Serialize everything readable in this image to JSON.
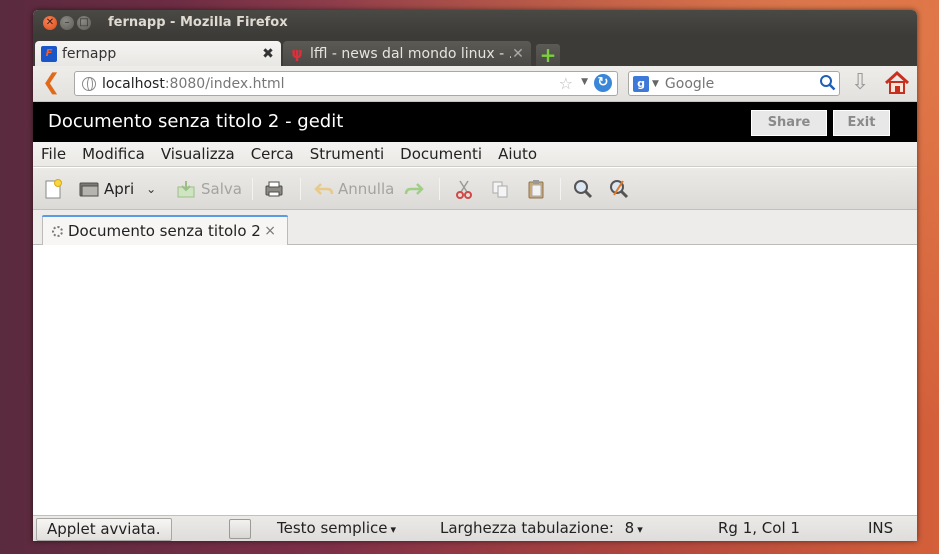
{
  "window": {
    "title": "fernapp - Mozilla Firefox"
  },
  "browser": {
    "tabs": [
      {
        "label": "fernapp",
        "active": true
      },
      {
        "label": "lffl - news dal mondo linux - …",
        "active": false
      }
    ],
    "new_tab_symbol": "+",
    "url": {
      "host": "localhost",
      "rest": ":8080/index.html"
    },
    "search": {
      "engine": "Google",
      "placeholder": "Google"
    },
    "icons": [
      "back-arrow-icon",
      "globe-icon",
      "star-icon",
      "reload-icon",
      "google-icon",
      "magnifier-icon",
      "download-icon",
      "home-icon"
    ]
  },
  "app": {
    "title": "Documento senza titolo 2 - gedit",
    "header_buttons": {
      "share": "Share",
      "exit": "Exit"
    },
    "menu": [
      "File",
      "Modifica",
      "Visualizza",
      "Cerca",
      "Strumenti",
      "Documenti",
      "Aiuto"
    ],
    "toolbar": {
      "open_label": "Apri",
      "save_label": "Salva",
      "undo_label": "Annulla"
    },
    "document_tab": {
      "label": "Documento senza titolo 2",
      "close": "×"
    },
    "statusbar": {
      "applet": "Applet avviata.",
      "language": "Testo semplice",
      "tab_width_label": "Larghezza tabulazione:",
      "tab_width_value": "8",
      "position": "Rg 1, Col 1",
      "mode": "INS"
    }
  },
  "colors": {
    "accent_tab": "#5a9be6",
    "header_bg": "#000000",
    "titlebar_bg": "#3c3b37",
    "close_button": "#df4a16"
  }
}
